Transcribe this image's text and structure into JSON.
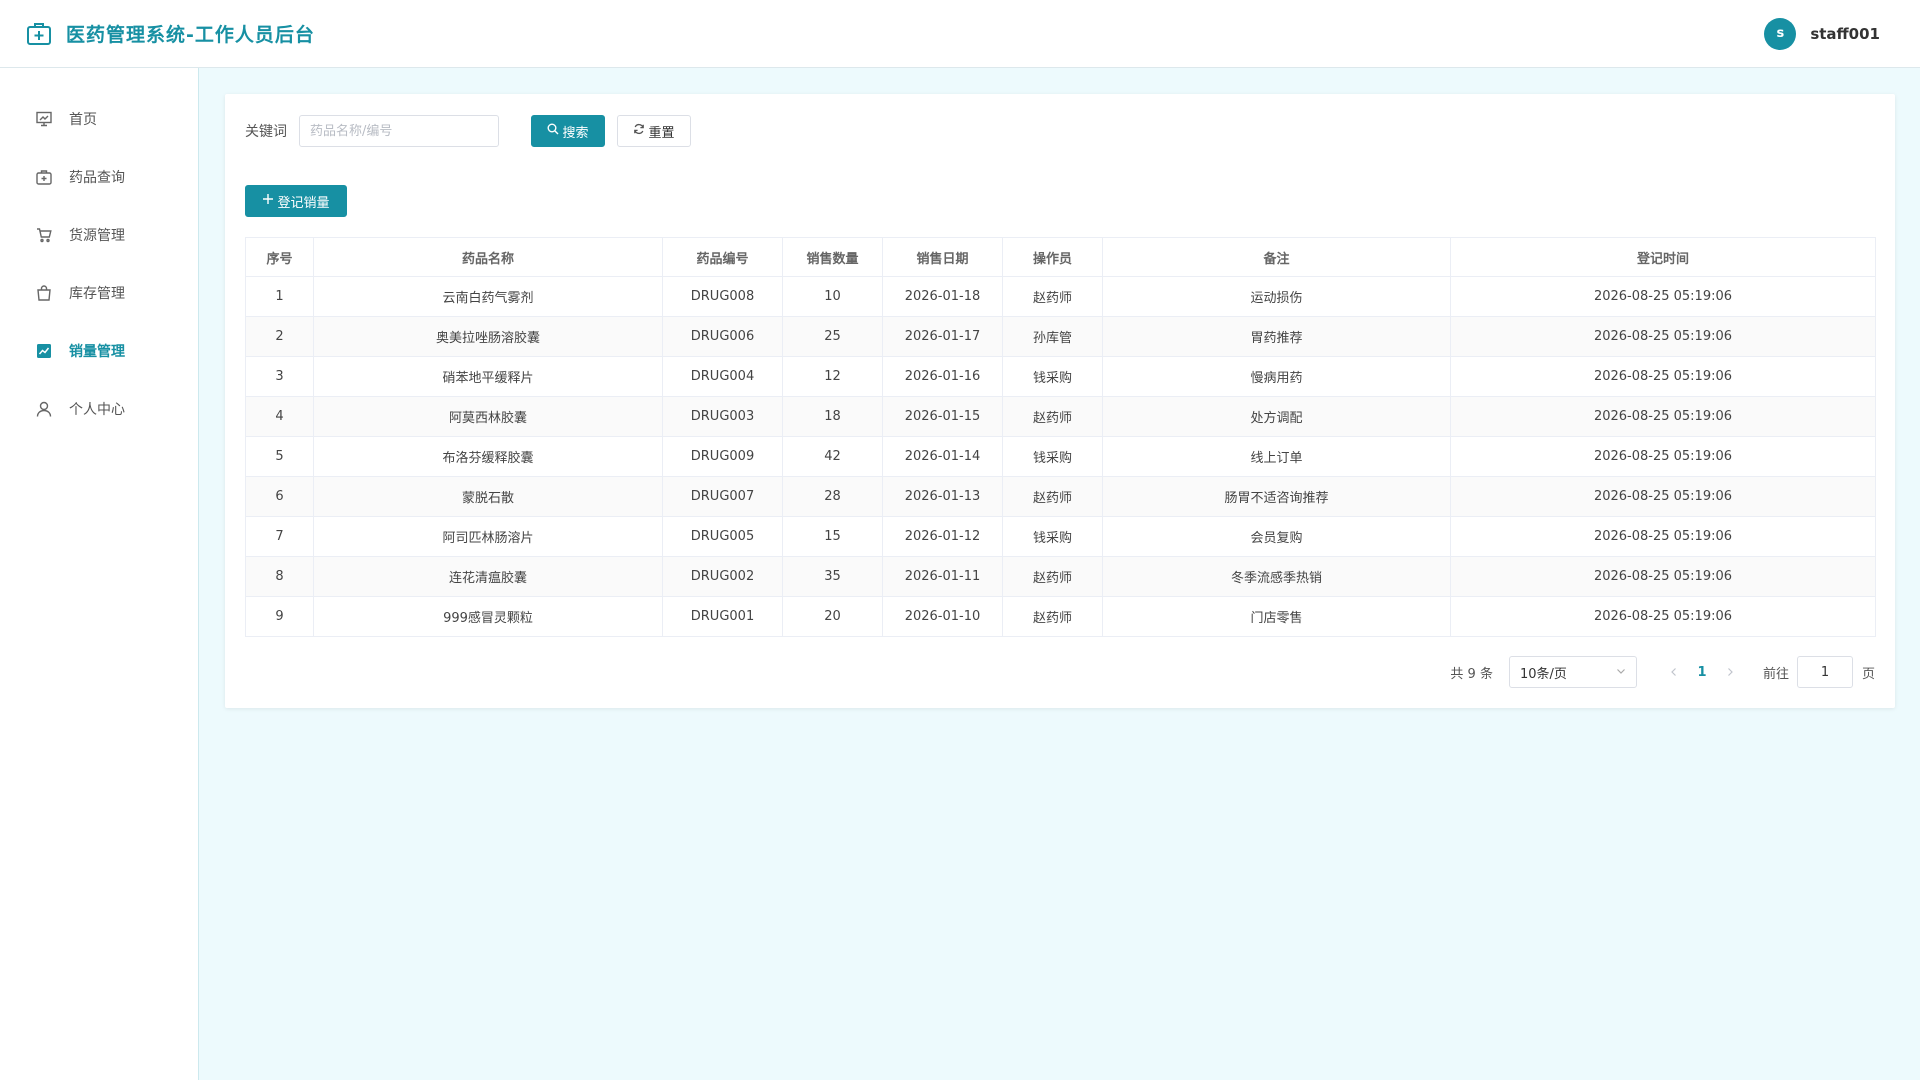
{
  "header": {
    "title": "医药管理系统-工作人员后台",
    "avatar_letter": "s",
    "username": "staff001"
  },
  "sidebar": {
    "items": [
      {
        "label": "首页",
        "icon": "dashboard-icon"
      },
      {
        "label": "药品查询",
        "icon": "medkit-icon"
      },
      {
        "label": "货源管理",
        "icon": "cart-icon"
      },
      {
        "label": "库存管理",
        "icon": "bag-icon"
      },
      {
        "label": "销量管理",
        "icon": "chart-icon",
        "active": true
      },
      {
        "label": "个人中心",
        "icon": "user-icon"
      }
    ]
  },
  "search": {
    "label": "关键词",
    "placeholder": "药品名称/编号",
    "search_button": "搜索",
    "reset_button": "重置"
  },
  "toolbar": {
    "add_button": "登记销量"
  },
  "table": {
    "columns": [
      "序号",
      "药品名称",
      "药品编号",
      "销售数量",
      "销售日期",
      "操作员",
      "备注",
      "登记时间"
    ],
    "rows": [
      [
        "1",
        "云南白药气雾剂",
        "DRUG008",
        "10",
        "2026-01-18",
        "赵药师",
        "运动损伤",
        "2026-08-25 05:19:06"
      ],
      [
        "2",
        "奥美拉唑肠溶胶囊",
        "DRUG006",
        "25",
        "2026-01-17",
        "孙库管",
        "胃药推荐",
        "2026-08-25 05:19:06"
      ],
      [
        "3",
        "硝苯地平缓释片",
        "DRUG004",
        "12",
        "2026-01-16",
        "钱采购",
        "慢病用药",
        "2026-08-25 05:19:06"
      ],
      [
        "4",
        "阿莫西林胶囊",
        "DRUG003",
        "18",
        "2026-01-15",
        "赵药师",
        "处方调配",
        "2026-08-25 05:19:06"
      ],
      [
        "5",
        "布洛芬缓释胶囊",
        "DRUG009",
        "42",
        "2026-01-14",
        "钱采购",
        "线上订单",
        "2026-08-25 05:19:06"
      ],
      [
        "6",
        "蒙脱石散",
        "DRUG007",
        "28",
        "2026-01-13",
        "赵药师",
        "肠胃不适咨询推荐",
        "2026-08-25 05:19:06"
      ],
      [
        "7",
        "阿司匹林肠溶片",
        "DRUG005",
        "15",
        "2026-01-12",
        "钱采购",
        "会员复购",
        "2026-08-25 05:19:06"
      ],
      [
        "8",
        "连花清瘟胶囊",
        "DRUG002",
        "35",
        "2026-01-11",
        "赵药师",
        "冬季流感季热销",
        "2026-08-25 05:19:06"
      ],
      [
        "9",
        "999感冒灵颗粒",
        "DRUG001",
        "20",
        "2026-01-10",
        "赵药师",
        "门店零售",
        "2026-08-25 05:19:06"
      ]
    ]
  },
  "pagination": {
    "total_text": "共 9 条",
    "page_size": "10条/页",
    "current_page": "1",
    "goto_label": "前往",
    "goto_value": "1",
    "goto_suffix": "页"
  },
  "colors": {
    "accent": "#1790a3",
    "background": "#edfafd"
  }
}
